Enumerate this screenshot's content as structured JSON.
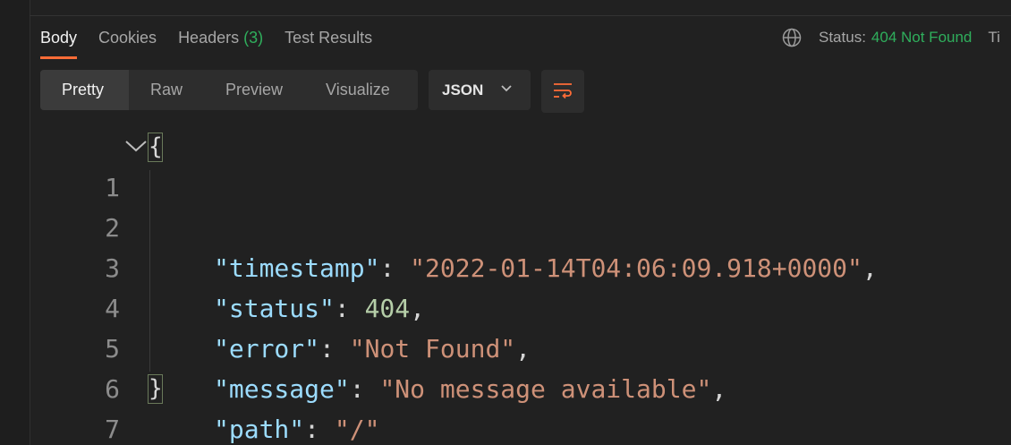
{
  "tabs": {
    "items": [
      {
        "label": "Body",
        "count": ""
      },
      {
        "label": "Cookies",
        "count": ""
      },
      {
        "label": "Headers",
        "count": "(3)"
      },
      {
        "label": "Test Results",
        "count": ""
      }
    ]
  },
  "status": {
    "label": "Status:",
    "value": "404 Not Found",
    "time_label_truncated": "Ti",
    "icon": "globe-icon",
    "value_color": "#2fae5c"
  },
  "toolbar": {
    "views": [
      "Pretty",
      "Raw",
      "Preview",
      "Visualize"
    ],
    "active_view": "Pretty",
    "format": "JSON",
    "wrap_icon": "wrap-lines-icon"
  },
  "code": {
    "line_numbers": [
      "1",
      "2",
      "3",
      "4",
      "5",
      "6",
      "7"
    ],
    "open_brace": "{",
    "close_brace": "}",
    "entries": [
      {
        "key": "\"timestamp\"",
        "value": "\"2022-01-14T04:06:09.918+0000\"",
        "type": "string",
        "comma": ","
      },
      {
        "key": "\"status\"",
        "value": "404",
        "type": "number",
        "comma": ","
      },
      {
        "key": "\"error\"",
        "value": "\"Not Found\"",
        "type": "string",
        "comma": ","
      },
      {
        "key": "\"message\"",
        "value": "\"No message available\"",
        "type": "string",
        "comma": ","
      },
      {
        "key": "\"path\"",
        "value": "\"/\"",
        "type": "string",
        "comma": ""
      }
    ]
  },
  "colors": {
    "accent": "#ff6c37",
    "success": "#2fae5c",
    "json_key": "#9cdcfe",
    "json_string": "#ce9178",
    "json_number": "#b5cea8"
  }
}
